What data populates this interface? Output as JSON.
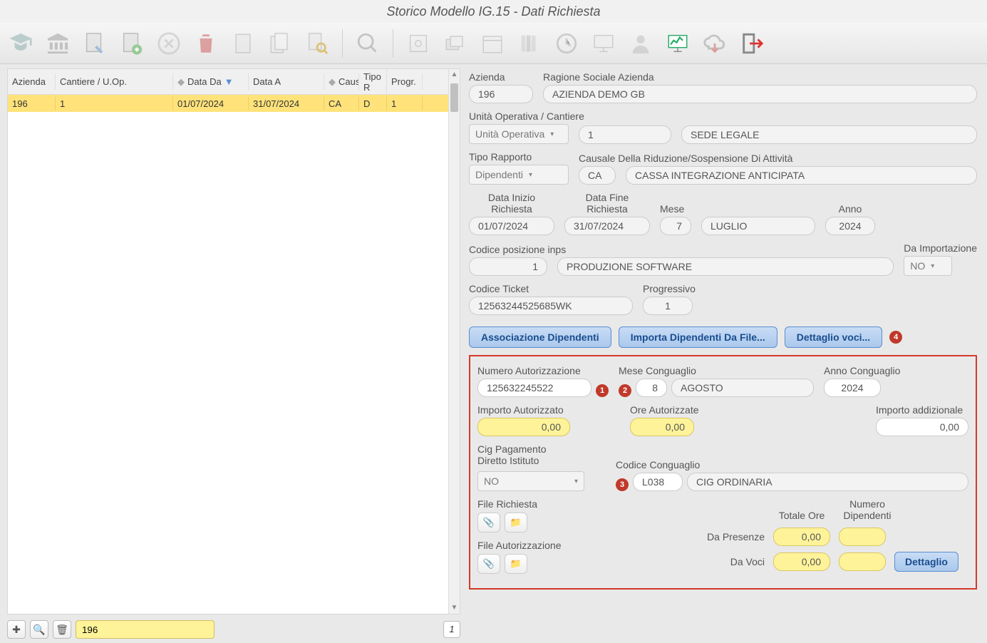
{
  "title": "Storico Modello IG.15 - Dati Richiesta",
  "table": {
    "headers": {
      "azienda": "Azienda",
      "cantiere": "Cantiere / U.Op.",
      "data_da": "Data Da",
      "data_a": "Data A",
      "causa": "Causa",
      "tipo": "Tipo R",
      "progr": "Progr."
    },
    "row": {
      "azienda": "196",
      "cantiere": "1",
      "data_da": "01/07/2024",
      "data_a": "31/07/2024",
      "causa": "CA",
      "tipo": "D",
      "progr": "1"
    }
  },
  "search_value": "196",
  "result_count": "1",
  "form": {
    "azienda_lbl": "Azienda",
    "azienda": "196",
    "ragione_lbl": "Ragione Sociale Azienda",
    "ragione": "AZIENDA DEMO GB",
    "unita_lbl": "Unità Operativa / Cantiere",
    "unita_sel": "Unità Operativa",
    "unita_cod": "1",
    "unita_desc": "SEDE LEGALE",
    "tipo_rapp_lbl": "Tipo Rapporto",
    "tipo_rapp": "Dipendenti",
    "causale_lbl": "Causale Della Riduzione/Sospensione Di Attività",
    "causale_cod": "CA",
    "causale_desc": "CASSA INTEGRAZIONE ANTICIPATA",
    "data_inizio_lbl": "Data Inizio Richiesta",
    "data_inizio": "01/07/2024",
    "data_fine_lbl": "Data Fine Richiesta",
    "data_fine": "31/07/2024",
    "mese_lbl": "Mese",
    "mese": "7",
    "mese_desc": "LUGLIO",
    "anno_lbl": "Anno",
    "anno": "2024",
    "inps_lbl": "Codice posizione inps",
    "inps_cod": "1",
    "inps_desc": "PRODUZIONE SOFTWARE",
    "daimp_lbl": "Da Importazione",
    "daimp": "NO",
    "ticket_lbl": "Codice Ticket",
    "ticket": "12563244525685WK",
    "progr_lbl": "Progressivo",
    "progr": "1"
  },
  "buttons": {
    "assoc": "Associazione Dipendenti",
    "importa": "Importa Dipendenti Da File...",
    "dettaglio": "Dettaglio voci..."
  },
  "box": {
    "numauth_lbl": "Numero Autorizzazione",
    "numauth": "125632245522",
    "mesecong_lbl": "Mese Conguaglio",
    "mesecong": "8",
    "mesecong_desc": "AGOSTO",
    "annocong_lbl": "Anno Conguaglio",
    "annocong": "2024",
    "impauth_lbl": "Importo Autorizzato",
    "impauth": "0,00",
    "oreauth_lbl": "Ore Autorizzate",
    "oreauth": "0,00",
    "impadd_lbl": "Importo addizionale",
    "impadd": "0,00",
    "cigpag_lbl": "Cig Pagamento Diretto Istituto",
    "cigpag": "NO",
    "codcong_lbl": "Codice Conguaglio",
    "codcong": "L038",
    "codcong_desc": "CIG ORDINARIA",
    "filereq_lbl": "File Richiesta",
    "fileauth_lbl": "File Autorizzazione",
    "totore_lbl": "Totale Ore",
    "numdip_lbl": "Numero Dipendenti",
    "dapres_lbl": "Da Presenze",
    "dapres": "0,00",
    "davoci_lbl": "Da Voci",
    "davoci": "0,00",
    "dettaglio_btn": "Dettaglio"
  },
  "badges": {
    "b1": "1",
    "b2": "2",
    "b3": "3",
    "b4": "4"
  }
}
